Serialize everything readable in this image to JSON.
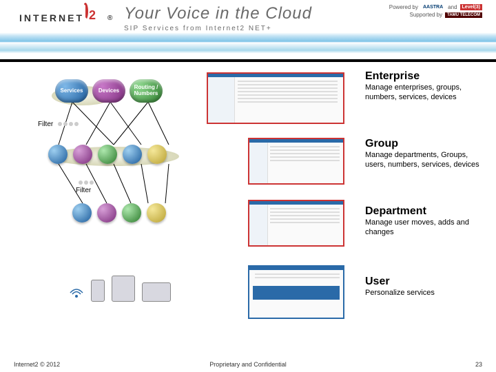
{
  "header": {
    "logo_text": "INTERNET",
    "logo_num": "2",
    "reg": "®",
    "title": "Your Voice in the Cloud",
    "subtitle": "SIP Services from Internet2 NET+",
    "powered_by": "Powered by",
    "supported_by": "Supported by",
    "and": "and",
    "partner1": "AASTRA",
    "partner2": "Level(3)",
    "partner3": "TAMU TELECOM"
  },
  "pills": {
    "services": "Services",
    "devices": "Devices",
    "routing": "Routing / Numbers"
  },
  "filter1": "Filter",
  "filter2": "Filter",
  "sections": {
    "enterprise": {
      "title": "Enterprise",
      "desc": "Manage enterprises, groups, numbers, services, devices"
    },
    "group": {
      "title": "Group",
      "desc": "Manage departments, Groups, users, numbers, services, devices"
    },
    "department": {
      "title": "Department",
      "desc": "Manage user moves, adds and changes"
    },
    "user": {
      "title": "User",
      "desc": "Personalize services"
    }
  },
  "footer": {
    "left": "Internet2 © 2012",
    "center": "Proprietary and Confidential",
    "right": "23"
  }
}
